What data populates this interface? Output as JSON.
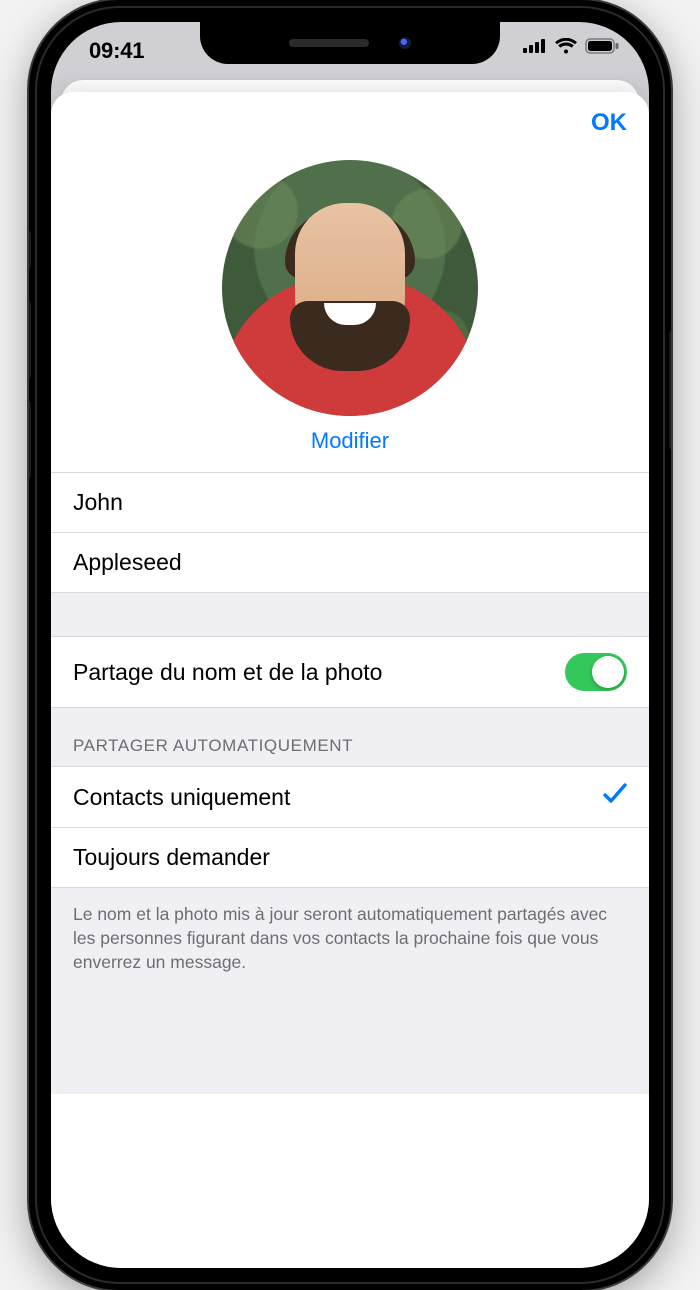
{
  "status": {
    "time": "09:41"
  },
  "header": {
    "ok_label": "OK"
  },
  "profile": {
    "edit_label": "Modifier",
    "first_name": "John",
    "last_name": "Appleseed"
  },
  "sharing": {
    "toggle_label": "Partage du nom et de la photo",
    "enabled": true,
    "auto_section_title": "PARTAGER AUTOMATIQUEMENT",
    "options": [
      {
        "label": "Contacts uniquement",
        "selected": true
      },
      {
        "label": "Toujours demander",
        "selected": false
      }
    ],
    "footer_text": "Le nom et la photo mis à jour seront automatiquement partagés avec les personnes figurant dans vos contacts la prochaine fois que vous enverrez un message."
  }
}
